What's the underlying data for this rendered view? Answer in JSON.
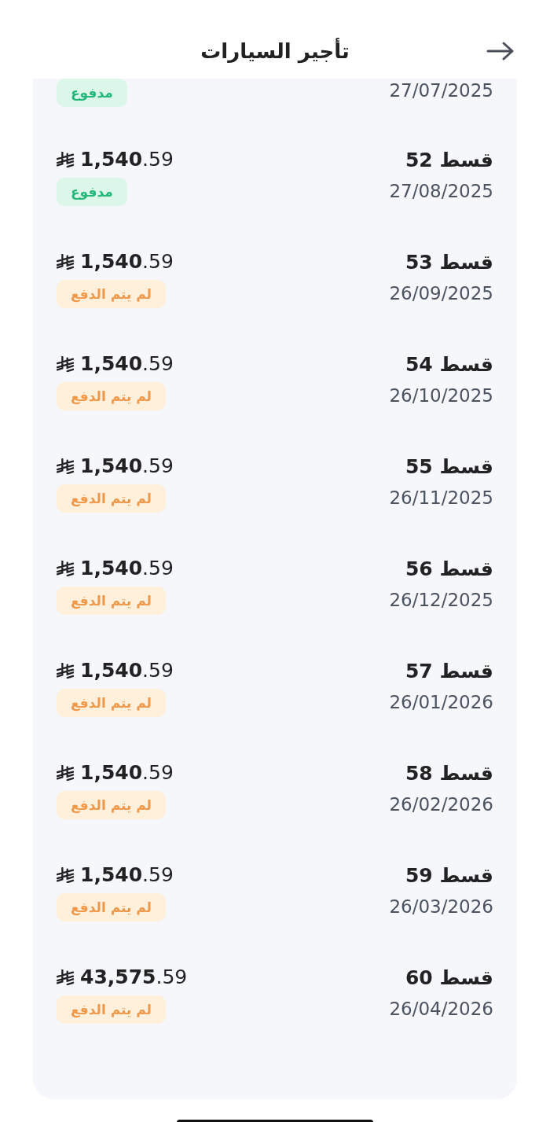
{
  "header": {
    "title": "تأجير السيارات"
  },
  "installments": [
    {
      "date": "27/07/2025",
      "paid": true,
      "badge": "مدفوع"
    },
    {
      "title": "قسط 52",
      "date": "27/08/2025",
      "amount": "**1,540**.59",
      "paid": true,
      "badge": "مدفوع"
    },
    {
      "title": "قسط 53",
      "date": "26/09/2025",
      "amount": "**1,540**.59",
      "paid": false,
      "badge": "لم يتم الدفع"
    },
    {
      "title": "قسط 54",
      "date": "26/10/2025",
      "amount": "**1,540**.59",
      "paid": false,
      "badge": "لم يتم الدفع"
    },
    {
      "title": "قسط 55",
      "date": "26/11/2025",
      "amount": "**1,540**.59",
      "paid": false,
      "badge": "لم يتم الدفع"
    },
    {
      "title": "قسط 56",
      "date": "26/12/2025",
      "amount": "**1,540**.59",
      "paid": false,
      "badge": "لم يتم الدفع"
    },
    {
      "title": "قسط 57",
      "date": "26/01/2026",
      "amount": "**1,540**.59",
      "paid": false,
      "badge": "لم يتم الدفع"
    },
    {
      "title": "قسط 58",
      "date": "26/02/2026",
      "amount": "**1,540**.59",
      "paid": false,
      "badge": "لم يتم الدفع"
    },
    {
      "title": "قسط 59",
      "date": "26/03/2026",
      "amount": "**1,540**.59",
      "paid": false,
      "badge": "لم يتم الدفع"
    },
    {
      "title": "قسط 60",
      "date": "26/04/2026",
      "amount": "**43,575**.59",
      "paid": false,
      "badge": "لم يتم الدفع"
    }
  ]
}
